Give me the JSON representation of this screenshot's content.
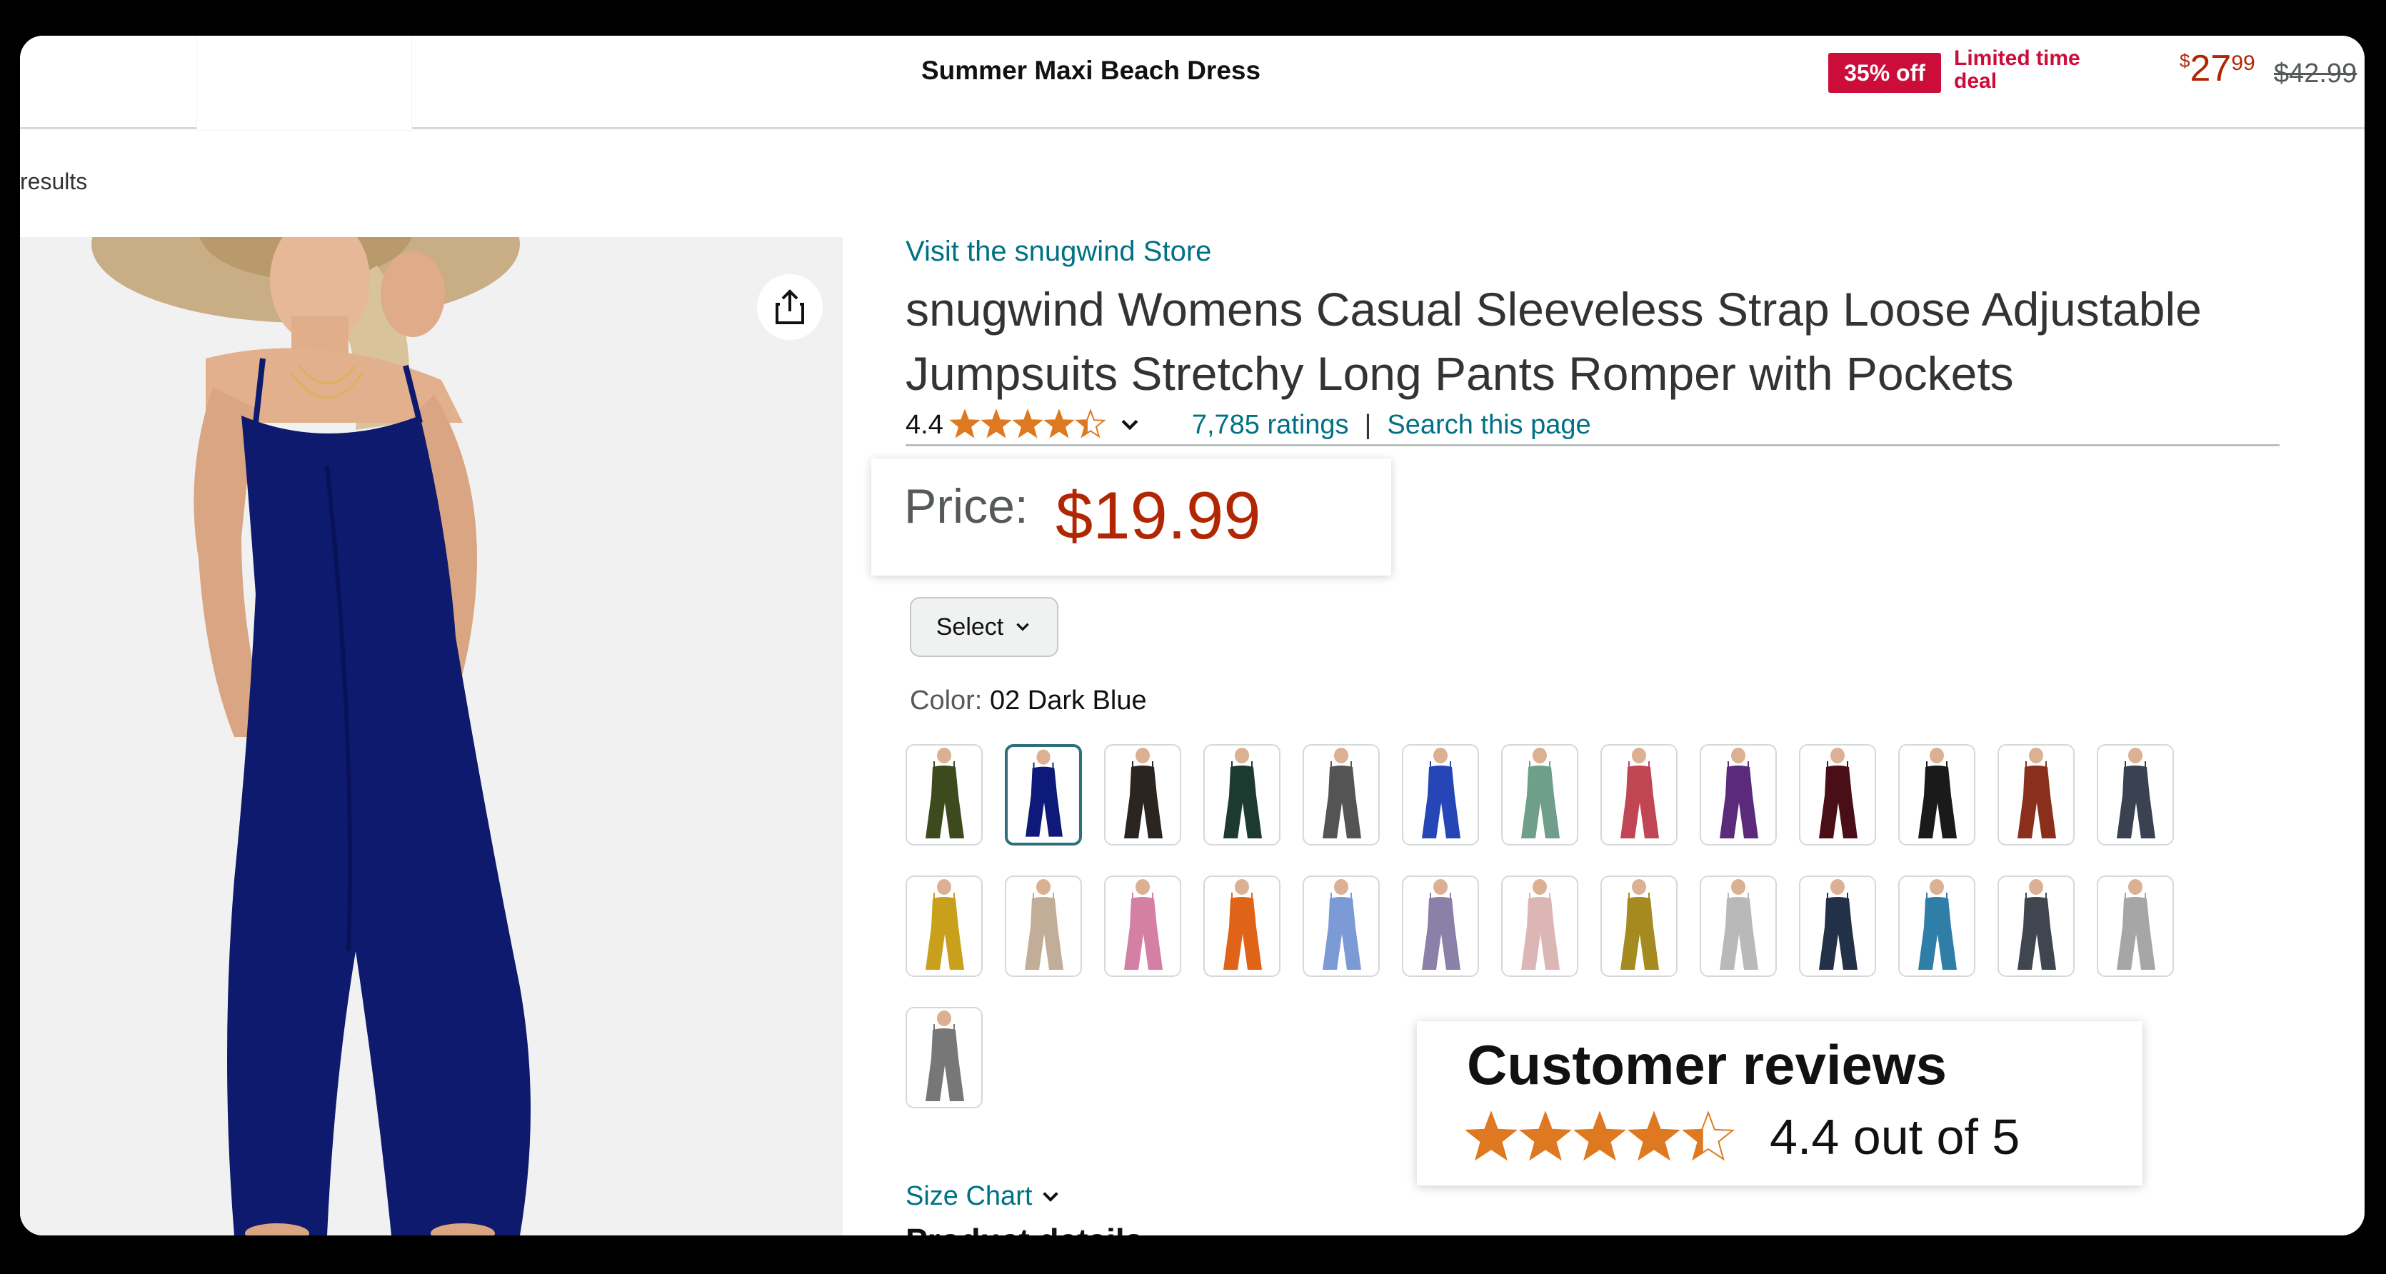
{
  "sticky_bar": {
    "title": "Summer Maxi Beach Dress",
    "deal_badge": "35% off",
    "deal_text": "Limited time deal",
    "price_symbol": "$",
    "price_whole": "27",
    "price_fraction": "99",
    "list_price": "$42.99"
  },
  "breadcrumb": {
    "results_link": "results"
  },
  "product": {
    "store_link": "Visit the snugwind Store",
    "title": "snugwind Womens Casual Sleeveless Strap Loose Adjustable Jumpsuits Stretchy Long Pants Romper with Pockets",
    "rating": "4.4",
    "rating_value": 4.4,
    "ratings_count": "7,785 ratings",
    "separator": "|",
    "search_link": "Search this page"
  },
  "price_box": {
    "label": "Price:",
    "value": "$19.99"
  },
  "size_select": {
    "label": "Select"
  },
  "color": {
    "label": "Color:",
    "selected": "02 Dark Blue",
    "swatches": [
      "#3c4a1e",
      "#0d1a7a",
      "#2b2522",
      "#1d3a30",
      "#545454",
      "#2646b8",
      "#6f9e8a",
      "#c14654",
      "#5c2a7a",
      "#4a0e17",
      "#1a1a1a",
      "#8a2f1c",
      "#3a4150",
      "#c9a01c",
      "#c2ae98",
      "#d47fa4",
      "#e06418",
      "#7b9ad6",
      "#8a80a8",
      "#dcb6b4",
      "#a58a20",
      "#b9b9b9",
      "#223048",
      "#2f7ea8",
      "#404650",
      "#a6a6a6",
      "#777777"
    ],
    "selected_index": 1
  },
  "size_chart": "Size Chart",
  "product_details": "Product details",
  "reviews": {
    "title": "Customer reviews",
    "score": "4.4 out of 5",
    "rating_value": 4.4
  },
  "colors": {
    "deal_red": "#cc0c39",
    "price_red": "#b12704",
    "link_teal": "#007185",
    "star_orange": "#de7921"
  }
}
